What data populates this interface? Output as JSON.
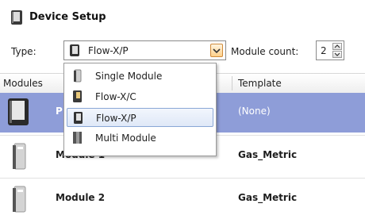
{
  "window": {
    "title": "Device Setup",
    "icon": "device-icon"
  },
  "type_field": {
    "label": "Type:",
    "value": "Flow-X/P"
  },
  "module_count": {
    "label": "Module count:",
    "value": "2"
  },
  "grid": {
    "columns": {
      "modules": "Modules",
      "template": "Template"
    },
    "rows": [
      {
        "name": "P",
        "template": "(None)",
        "selected": true
      },
      {
        "name": "Module 1",
        "template": "Gas_Metric"
      },
      {
        "name": "Module 2",
        "template": "Gas_Metric"
      }
    ]
  },
  "type_dropdown": {
    "options": [
      {
        "label": "Single Module",
        "icon": "single-module-icon"
      },
      {
        "label": "Flow-X/C",
        "icon": "flow-x-c-icon"
      },
      {
        "label": "Flow-X/P",
        "icon": "flow-x-p-icon",
        "selected": true
      },
      {
        "label": "Multi Module",
        "icon": "multi-module-icon"
      }
    ]
  },
  "colors": {
    "selection": "#8e9dd8",
    "dropdown_highlight": "#dfe8f7",
    "dropdown_button": "#ffd08a"
  }
}
